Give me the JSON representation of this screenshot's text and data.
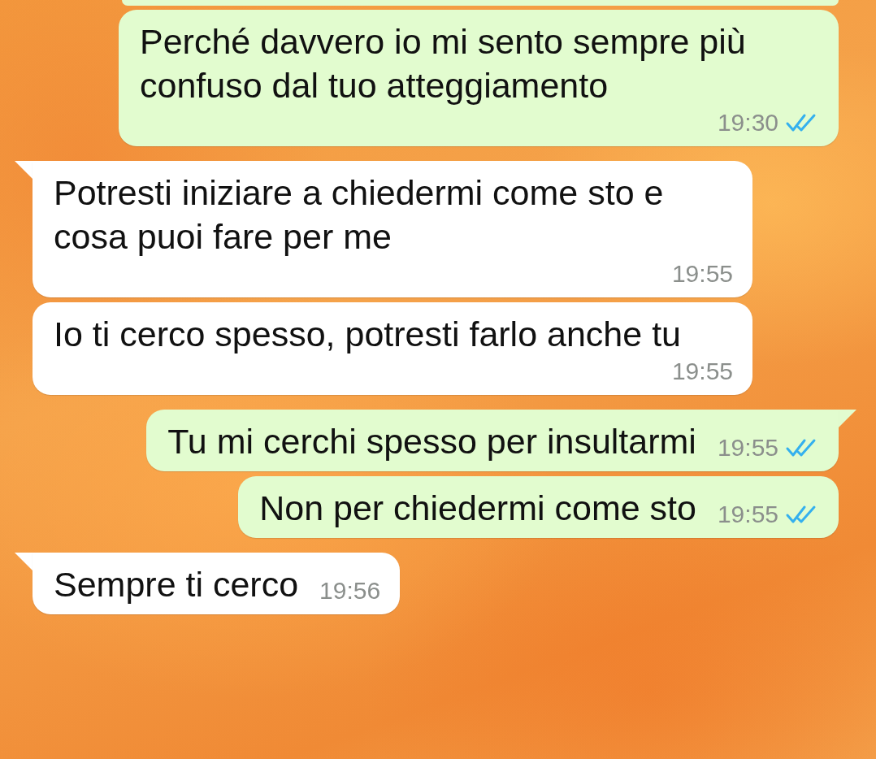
{
  "messages": [
    {
      "kind": "outgoing",
      "tail": false,
      "text": "Perché davvero io mi sento sempre più confuso dal tuo atteggiamento",
      "time": "19:30",
      "read": true
    },
    {
      "kind": "incoming",
      "tail": true,
      "text": "Potresti iniziare a chiedermi come sto e cosa puoi fare per me",
      "time": "19:55"
    },
    {
      "kind": "incoming",
      "tail": false,
      "text": "Io ti cerco spesso, potresti farlo anche tu",
      "time": "19:55"
    },
    {
      "kind": "outgoing",
      "tail": true,
      "text": "Tu mi cerchi spesso per insultarmi",
      "time": "19:55",
      "read": true
    },
    {
      "kind": "outgoing",
      "tail": false,
      "text": "Non per chiedermi come sto",
      "time": "19:55",
      "read": true
    },
    {
      "kind": "incoming",
      "tail": true,
      "text": "Sempre ti cerco",
      "time": "19:56"
    }
  ]
}
